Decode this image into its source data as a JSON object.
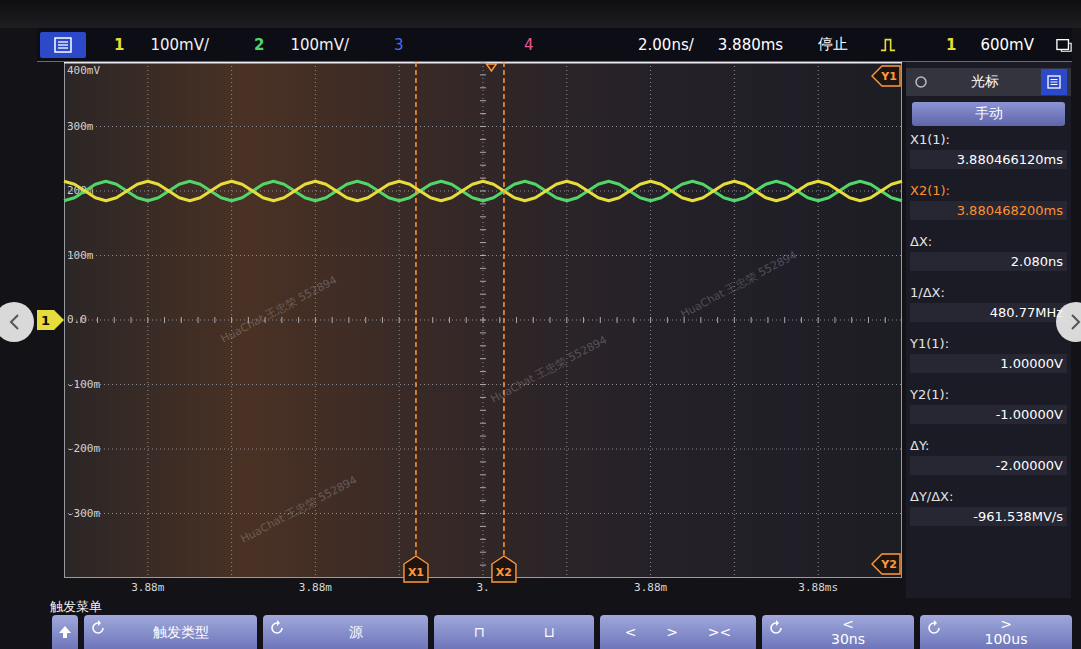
{
  "top_bar": {
    "channels": [
      {
        "number": "1",
        "scale": "100mV/",
        "on": true,
        "color": "#e6dc3c"
      },
      {
        "number": "2",
        "scale": "100mV/",
        "on": true,
        "color": "#52d66a"
      },
      {
        "number": "3",
        "on": false,
        "color": "#4a78ff"
      },
      {
        "number": "4",
        "on": false,
        "color": "#ff5c9c"
      }
    ],
    "timebase": "2.00ns/",
    "delay": "3.880ms",
    "run_state": "停止",
    "trigger": {
      "source": "1",
      "level": "600mV"
    }
  },
  "chart": {
    "y_axis": {
      "top": 400,
      "unit_per_div": 100,
      "labels": [
        "400mV",
        "300m",
        "200m",
        "100m",
        "0.0",
        "-100m",
        "-200m",
        "-300m"
      ]
    },
    "x_axis": {
      "labels": [
        "3.88m",
        "3.88m",
        "3.",
        "3.88m",
        "3.88ms"
      ]
    },
    "series": [
      {
        "color": "#52d66a",
        "values": [
          185,
          189.4,
          200,
          210.6,
          215,
          210.6,
          200,
          189.4,
          185,
          189.4,
          200,
          210.6,
          215,
          210.6,
          200,
          189.4,
          185,
          189.4,
          200,
          210.6,
          215,
          210.6,
          200,
          189.4,
          185,
          189.4,
          200,
          210.6,
          215,
          210.6,
          200,
          189.4,
          185,
          189.4,
          200,
          210.6,
          215,
          210.6,
          200,
          189.4,
          185,
          189.4,
          200,
          210.6,
          215,
          210.6,
          200,
          189.4,
          185,
          189.4,
          200,
          210.6,
          215,
          210.6,
          200,
          189.4,
          185,
          189.4,
          200,
          210.6,
          215,
          210.6,
          200,
          189.4,
          185,
          189.4,
          200,
          210.6,
          215,
          210.6,
          200,
          189.4,
          185,
          189.4,
          200,
          210.6,
          215,
          210.6,
          200,
          189.4,
          185
        ]
      },
      {
        "color": "#e6dc3c",
        "values": [
          215,
          210.6,
          200,
          189.4,
          185,
          189.4,
          200,
          210.6,
          215,
          210.6,
          200,
          189.4,
          185,
          189.4,
          200,
          210.6,
          215,
          210.6,
          200,
          189.4,
          185,
          189.4,
          200,
          210.6,
          215,
          210.6,
          200,
          189.4,
          185,
          189.4,
          200,
          210.6,
          215,
          210.6,
          200,
          189.4,
          185,
          189.4,
          200,
          210.6,
          215,
          210.6,
          200,
          189.4,
          185,
          189.4,
          200,
          210.6,
          215,
          210.6,
          200,
          189.4,
          185,
          189.4,
          200,
          210.6,
          215,
          210.6,
          200,
          189.4,
          185,
          189.4,
          200,
          210.6,
          215,
          210.6,
          200,
          189.4,
          185,
          189.4,
          200,
          210.6,
          215,
          210.6,
          200,
          189.4,
          185,
          189.4,
          200,
          210.6,
          215
        ]
      }
    ],
    "cursors": [
      {
        "label": "X1",
        "x_div": 4.2
      },
      {
        "label": "X2",
        "x_div": 5.25
      }
    ],
    "y_markers": [
      {
        "label": "Y1"
      },
      {
        "label": "Y2"
      }
    ],
    "ground_marker": "1",
    "watermarks": [
      "HuaChat 王忠荣 552894",
      "HuaChat 王忠荣 552894",
      "HuaChat 王忠荣 552894",
      "HuaChat 王忠荣 552894"
    ]
  },
  "cursor_panel": {
    "title": "光标",
    "mode": "手动",
    "rows": [
      {
        "label": "X1(1):",
        "value": "3.880466120ms",
        "selected": false
      },
      {
        "label": "X2(1):",
        "value": "3.880468200ms",
        "selected": true
      },
      {
        "label": "ΔX:",
        "value": "2.080ns",
        "selected": false
      },
      {
        "label": "1/ΔX:",
        "value": "480.77MHz",
        "selected": false
      },
      {
        "label": "Y1(1):",
        "value": "1.00000V",
        "selected": false
      },
      {
        "label": "Y2(1):",
        "value": "-1.00000V",
        "selected": false
      },
      {
        "label": "ΔY:",
        "value": "-2.00000V",
        "selected": false
      },
      {
        "label": "ΔY/ΔX:",
        "value": "-961.538MV/s",
        "selected": false
      }
    ]
  },
  "softkeys": {
    "menu": "触发菜单",
    "keys": [
      {
        "kind": "knob",
        "texts": [
          "触发类型"
        ]
      },
      {
        "kind": "knob",
        "texts": [
          "源"
        ]
      },
      {
        "kind": "row",
        "texts": [
          "⊓",
          "⊔"
        ]
      },
      {
        "kind": "row",
        "texts": [
          "<",
          ">",
          "><"
        ]
      },
      {
        "kind": "knob",
        "texts": [
          "<",
          "30ns"
        ]
      },
      {
        "kind": "knob",
        "texts": [
          ">",
          "100us"
        ]
      }
    ]
  }
}
